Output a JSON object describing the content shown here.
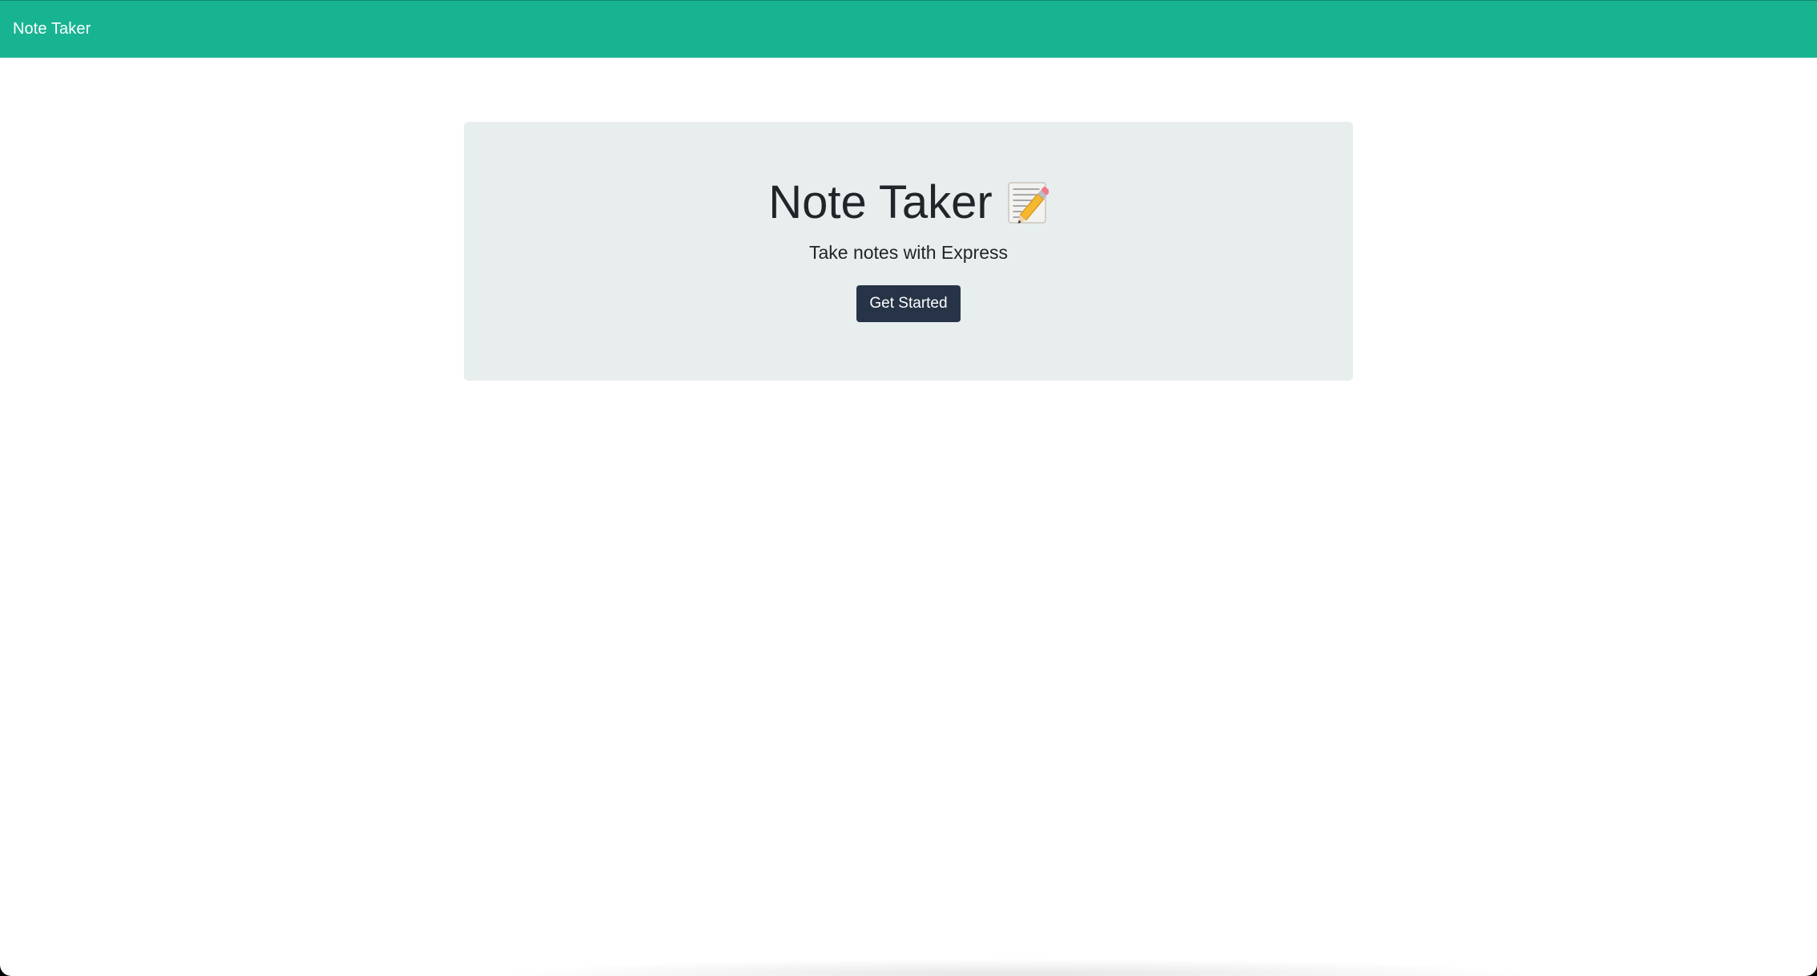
{
  "navbar": {
    "brand": "Note Taker",
    "color": "#18b492"
  },
  "hero": {
    "title": "Note Taker",
    "icon": "memo-pencil-icon",
    "subtitle": "Take notes with Express",
    "cta_label": "Get Started",
    "background": "#e8eeee",
    "button_color": "#273346"
  }
}
